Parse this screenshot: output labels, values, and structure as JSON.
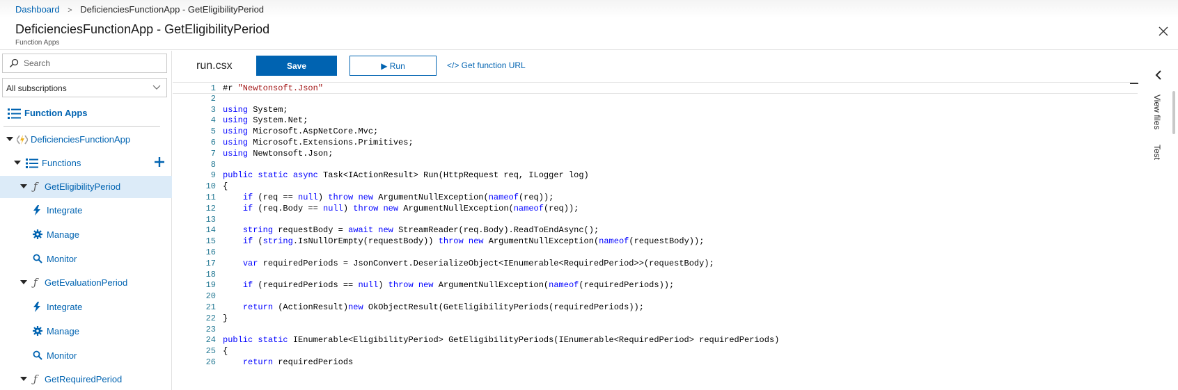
{
  "breadcrumb": {
    "root": "Dashboard",
    "current": "DeficienciesFunctionApp - GetEligibilityPeriod"
  },
  "header": {
    "title": "DeficienciesFunctionApp - GetEligibilityPeriod",
    "subtitle": "Function Apps"
  },
  "sidebar": {
    "search_placeholder": "Search",
    "subscription": "All subscriptions",
    "items": [
      {
        "label": "Function Apps",
        "icon": "list-icon"
      },
      {
        "label": "DeficienciesFunctionApp",
        "icon": "function-app-icon"
      },
      {
        "label": "Functions",
        "icon": "list-icon"
      },
      {
        "label": "GetEligibilityPeriod",
        "icon": "function-icon"
      },
      {
        "label": "Integrate",
        "icon": "lightning-icon"
      },
      {
        "label": "Manage",
        "icon": "gear-icon"
      },
      {
        "label": "Monitor",
        "icon": "search-icon"
      },
      {
        "label": "GetEvaluationPeriod",
        "icon": "function-icon"
      },
      {
        "label": "Integrate",
        "icon": "lightning-icon"
      },
      {
        "label": "Manage",
        "icon": "gear-icon"
      },
      {
        "label": "Monitor",
        "icon": "search-icon"
      },
      {
        "label": "GetRequiredPeriod",
        "icon": "function-icon"
      }
    ]
  },
  "editor": {
    "file_name": "run.csx",
    "save_label": "Save",
    "run_label": "▶ Run",
    "url_label": "</> Get function URL",
    "lines": [
      {
        "n": "1",
        "text": "#r \"Newtonsoft.Json\""
      },
      {
        "n": "2",
        "text": ""
      },
      {
        "n": "3",
        "text": "using System;"
      },
      {
        "n": "4",
        "text": "using System.Net;"
      },
      {
        "n": "5",
        "text": "using Microsoft.AspNetCore.Mvc;"
      },
      {
        "n": "6",
        "text": "using Microsoft.Extensions.Primitives;"
      },
      {
        "n": "7",
        "text": "using Newtonsoft.Json;"
      },
      {
        "n": "8",
        "text": ""
      },
      {
        "n": "9",
        "text": "public static async Task<IActionResult> Run(HttpRequest req, ILogger log)"
      },
      {
        "n": "10",
        "text": "{"
      },
      {
        "n": "11",
        "text": "    if (req == null) throw new ArgumentNullException(nameof(req));"
      },
      {
        "n": "12",
        "text": "    if (req.Body == null) throw new ArgumentNullException(nameof(req));"
      },
      {
        "n": "13",
        "text": ""
      },
      {
        "n": "14",
        "text": "    string requestBody = await new StreamReader(req.Body).ReadToEndAsync();"
      },
      {
        "n": "15",
        "text": "    if (string.IsNullOrEmpty(requestBody)) throw new ArgumentNullException(nameof(requestBody));"
      },
      {
        "n": "16",
        "text": ""
      },
      {
        "n": "17",
        "text": "    var requiredPeriods = JsonConvert.DeserializeObject<IEnumerable<RequiredPeriod>>(requestBody);"
      },
      {
        "n": "18",
        "text": ""
      },
      {
        "n": "19",
        "text": "    if (requiredPeriods == null) throw new ArgumentNullException(nameof(requiredPeriods));"
      },
      {
        "n": "20",
        "text": ""
      },
      {
        "n": "21",
        "text": "    return (ActionResult)new OkObjectResult(GetEligibilityPeriods(requiredPeriods));"
      },
      {
        "n": "22",
        "text": "}"
      },
      {
        "n": "23",
        "text": ""
      },
      {
        "n": "24",
        "text": "public static IEnumerable<EligibilityPeriod> GetEligibilityPeriods(IEnumerable<RequiredPeriod> requiredPeriods)"
      },
      {
        "n": "25",
        "text": "{"
      },
      {
        "n": "26",
        "text": "    return requiredPeriods"
      }
    ]
  },
  "right_rail": {
    "view_files_label": "View files",
    "test_label": "Test"
  },
  "colors": {
    "accent": "#0063b1",
    "selected_bg": "#dcebf8",
    "keyword": "#0000ff",
    "string": "#a31515",
    "line_number": "#237893"
  }
}
